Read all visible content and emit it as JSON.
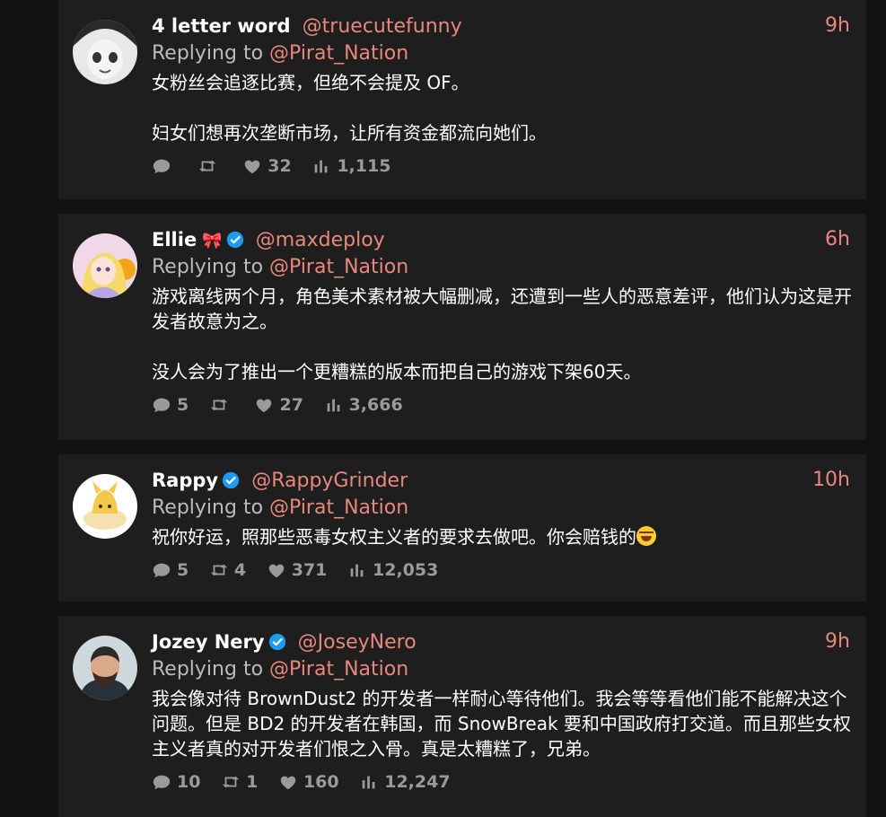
{
  "tweets": [
    {
      "name": "4 letter word",
      "badge": "",
      "handle": "@truecutefunny",
      "time": "9h",
      "reply_prefix": "Replying to",
      "reply_to": "@Pirat_Nation",
      "body": "女粉丝会追逐比赛，但绝不会提及 OF。\n\n妇女们想再次垄断市场，让所有资金都流向她们。",
      "comments": "",
      "retweets": "",
      "likes": "32",
      "views": "1,115"
    },
    {
      "name": "Ellie",
      "badge": "🎀",
      "handle": "@maxdeploy",
      "time": "6h",
      "reply_prefix": "Replying to",
      "reply_to": "@Pirat_Nation",
      "body": "游戏离线两个月，角色美术素材被大幅删减，还遭到一些人的恶意差评，他们认为这是开发者故意为之。\n\n没人会为了推出一个更糟糕的版本而把自己的游戏下架60天。",
      "comments": "5",
      "retweets": "",
      "likes": "27",
      "views": "3,666"
    },
    {
      "name": "Rappy",
      "badge": "",
      "handle": "@RappyGrinder",
      "time": "10h",
      "reply_prefix": "Replying to",
      "reply_to": "@Pirat_Nation",
      "body": "祝你好运，照那些恶毒女权主义者的要求去做吧。你会赔钱的",
      "comments": "5",
      "retweets": "4",
      "likes": "371",
      "views": "12,053"
    },
    {
      "name": "Jozey Nery",
      "badge": "",
      "handle": "@JoseyNero",
      "time": "9h",
      "reply_prefix": "Replying to",
      "reply_to": "@Pirat_Nation",
      "body": "我会像对待 BrownDust2 的开发者一样耐心等待他们。我会等等看他们能不能解决这个问题。但是 BD2 的开发者在韩国，而 SnowBreak 要和中国政府打交道。而且那些女权主义者真的对开发者们恨之入骨。真是太糟糕了，兄弟。",
      "comments": "10",
      "retweets": "1",
      "likes": "160",
      "views": "12,247"
    }
  ],
  "icons": {
    "comment": "comment-icon",
    "retweet": "retweet-icon",
    "like": "heart-icon",
    "views": "views-icon",
    "verified": "verified-badge-icon"
  },
  "colors": {
    "accent": "#e8877b",
    "verified": "#1d9bf0",
    "card": "#1e1e1e",
    "background": "#111111"
  }
}
